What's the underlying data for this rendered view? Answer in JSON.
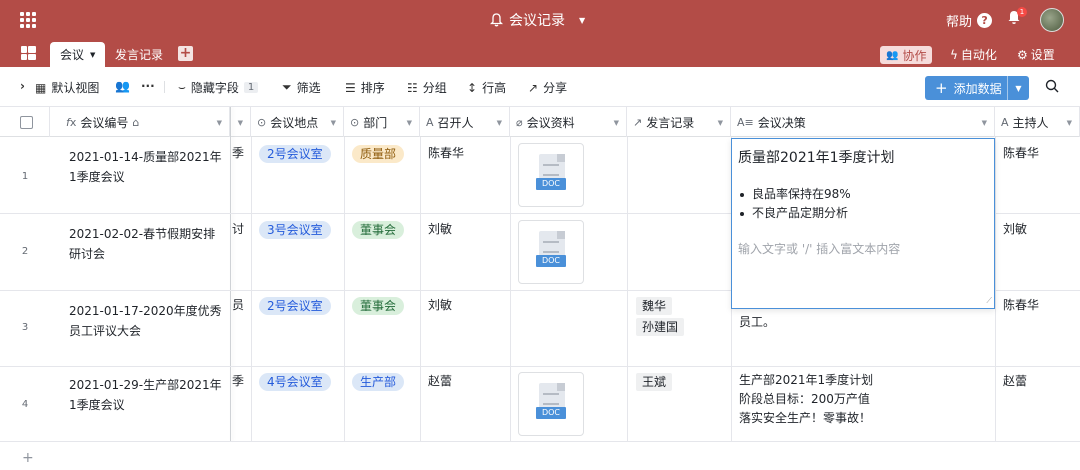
{
  "header": {
    "title": "会议记录",
    "help": "帮助",
    "notify_count": "1"
  },
  "tabs": [
    {
      "label": "会议"
    },
    {
      "label": "发言记录"
    }
  ],
  "topright": {
    "collab": "协作",
    "automation": "自动化",
    "settings": "设置"
  },
  "toolbar": {
    "view": "默认视图",
    "hidden_fields": "隐藏字段",
    "hidden_count": "1",
    "filter": "筛选",
    "sort": "排序",
    "group": "分组",
    "row_height": "行高",
    "share": "分享",
    "add_data": "添加数据"
  },
  "columns": {
    "id": "会议编号",
    "location": "会议地点",
    "dept": "部门",
    "host": "召开人",
    "material": "会议资料",
    "speech": "发言记录",
    "decision": "会议决策",
    "moderator": "主持人"
  },
  "rows": [
    {
      "num": "1",
      "id": "2021-01-14-质量部2021年1季度会议",
      "clip": "季",
      "room": "2号会议室",
      "dept": "质量部",
      "host": "陈春华",
      "doc": "DOC",
      "speakers": [],
      "decision": [],
      "moderator": "陈春华"
    },
    {
      "num": "2",
      "id": "2021-02-02-春节假期安排研讨会",
      "clip": "讨",
      "room": "3号会议室",
      "dept": "董事会",
      "host": "刘敏",
      "doc": "DOC",
      "speakers": [],
      "decision": [],
      "moderator": "刘敏"
    },
    {
      "num": "3",
      "id": "2021-01-17-2020年度优秀员工评议大会",
      "clip": "员",
      "room": "2号会议室",
      "dept": "董事会",
      "host": "刘敏",
      "doc": "",
      "speakers": [
        "魏华",
        "孙建国"
      ],
      "decision": [
        "员工。"
      ],
      "moderator": "陈春华"
    },
    {
      "num": "4",
      "id": "2021-01-29-生产部2021年1季度会议",
      "clip": "季",
      "room": "4号会议室",
      "dept": "生产部",
      "host": "赵蕾",
      "doc": "DOC",
      "speakers": [
        "王斌"
      ],
      "decision": [
        "生产部2021年1季度计划",
        "阶段总目标：200万产值",
        "落实安全生产！零事故！"
      ],
      "moderator": "赵蕾"
    }
  ],
  "editor": {
    "title": "质量部2021年1季度计划",
    "bullets": [
      "良品率保持在98%",
      "不良产品定期分析"
    ],
    "placeholder": "输入文字或 '/' 插入富文本内容"
  },
  "colors": {
    "topbar": "#b34c47",
    "accent": "#4a90d9"
  }
}
